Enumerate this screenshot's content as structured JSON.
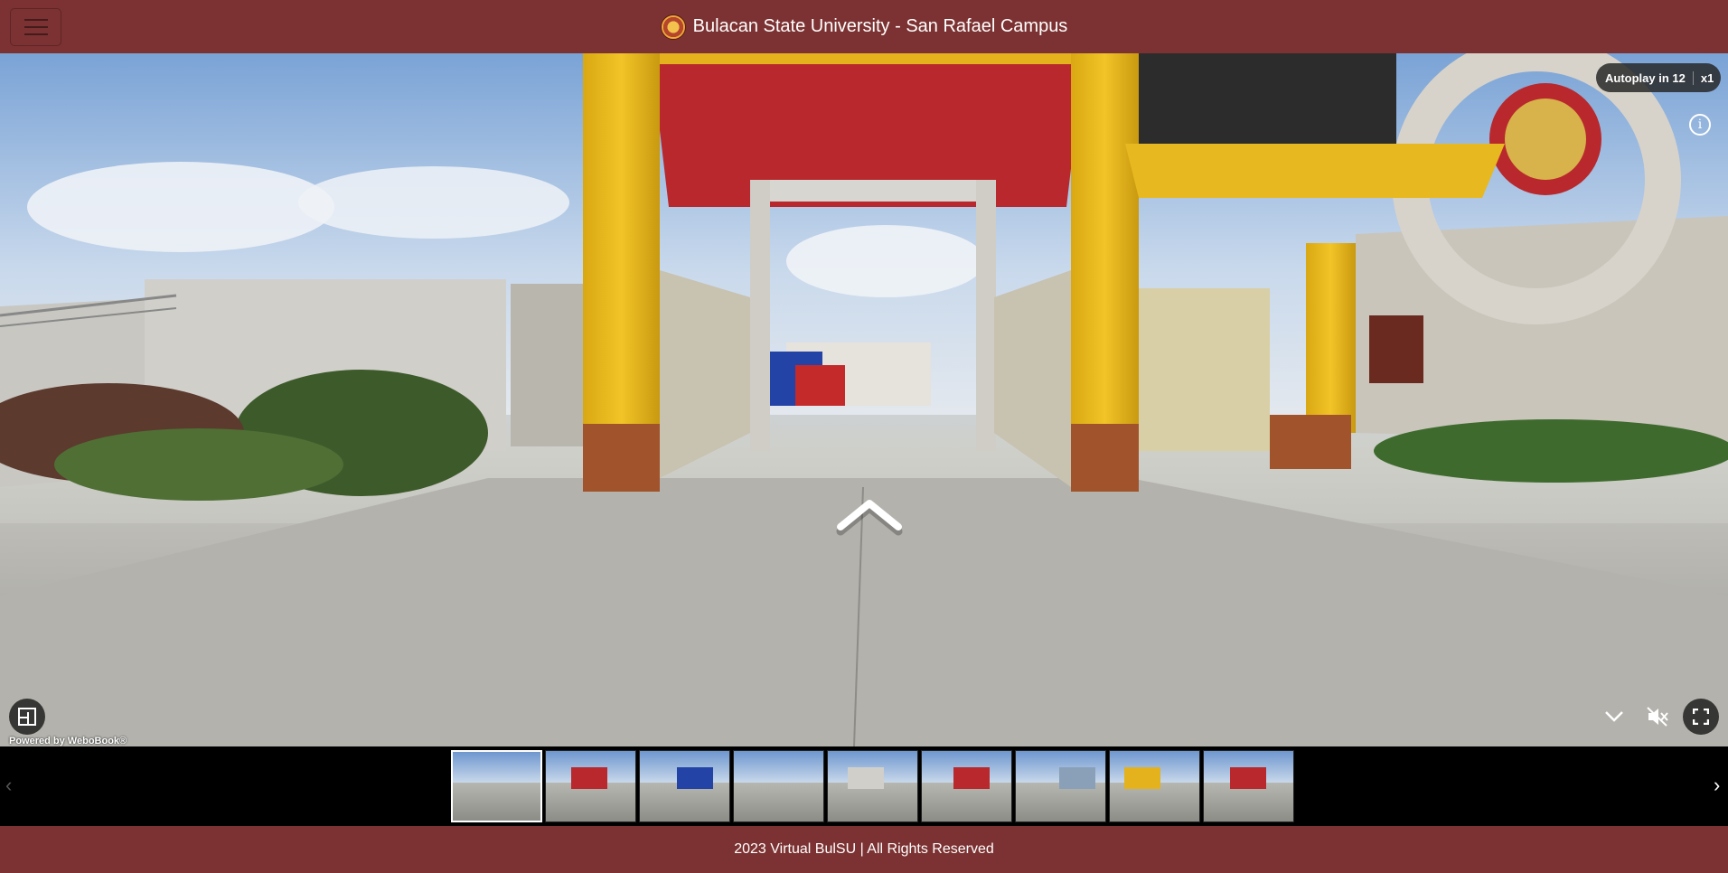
{
  "header": {
    "title": "Bulacan State University - San Rafael Campus",
    "menu_icon": "hamburger-menu-icon",
    "logo_icon": "university-seal-logo"
  },
  "viewer": {
    "autoplay_label": "Autoplay in 12",
    "autoplay_speed": "x1",
    "info_icon": "info-icon",
    "info_glyph": "i",
    "powered_by": "Powered by WeboBook®",
    "hotspot_icon": "chevron-up-navigation-icon"
  },
  "thumbnails": {
    "count": 9,
    "active_index": 0,
    "prev_glyph": "‹",
    "next_glyph": "›"
  },
  "footer": {
    "text": "2023 Virtual BulSU | All Rights Reserved"
  },
  "colors": {
    "brand": "#7c3232",
    "gate_yellow": "#e3b21d",
    "canopy_red": "#b8282c"
  }
}
